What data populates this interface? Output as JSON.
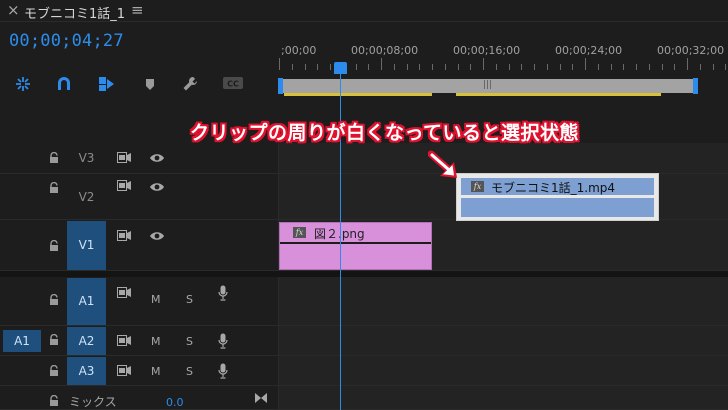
{
  "header": {
    "close_glyph": "×",
    "title": "モブニコミ1話_1",
    "menu_glyph": "≡"
  },
  "timecode": "00;00;04;27",
  "toolbar": {
    "items": [
      {
        "name": "nest-sequence-icon"
      },
      {
        "name": "snap-icon"
      },
      {
        "name": "linked-selection-icon"
      },
      {
        "name": "add-marker-icon"
      },
      {
        "name": "settings-wrench-icon"
      },
      {
        "name": "captions-icon",
        "label": "CC"
      }
    ]
  },
  "ruler": {
    "labels": [
      ";00;00",
      "00;00;08;00",
      "00;00;16;00",
      "00;00;24;00",
      "00;00;32;00"
    ],
    "grip": "|||"
  },
  "tracks": {
    "video": [
      {
        "name": "V3"
      },
      {
        "name": "V2"
      },
      {
        "name": "V1",
        "active": true
      }
    ],
    "audio": [
      {
        "name": "A1",
        "mute": "M",
        "solo": "S"
      },
      {
        "name": "A2",
        "mute": "M",
        "solo": "S",
        "source_target": "A1"
      },
      {
        "name": "A3",
        "mute": "M",
        "solo": "S"
      }
    ],
    "mix": {
      "label": "ミックス",
      "value": "0.0"
    }
  },
  "clips": {
    "v1": {
      "fx": "fx",
      "name": "図２.png",
      "color": "#d890da"
    },
    "v2": {
      "fx": "fx",
      "name": "モブニコミ1話_1.mp4",
      "color": "#7d9fd2",
      "selected": true
    }
  },
  "annotation": {
    "text": "クリップの周りが白くなっていると選択状態",
    "color": "#e0122f"
  },
  "colors": {
    "accent": "#2d8ceb",
    "target": "#1f4f7c"
  }
}
